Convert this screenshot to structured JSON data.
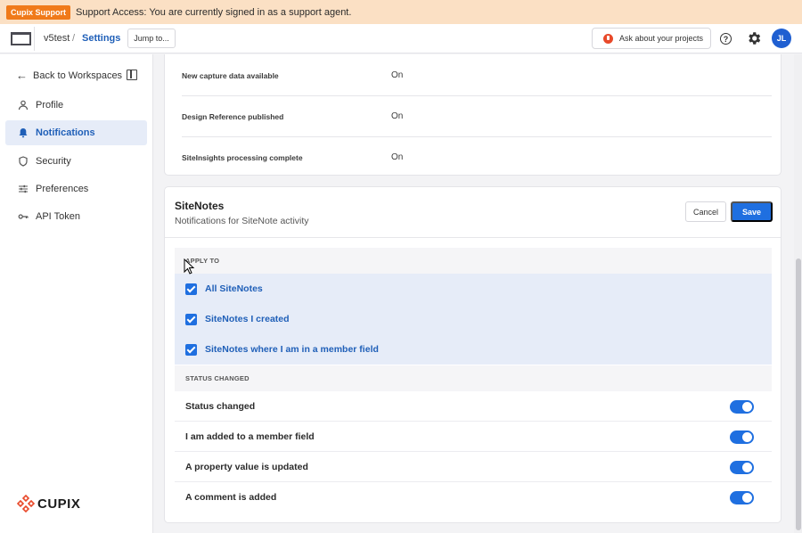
{
  "banner": {
    "badge": "Cupix Support",
    "message": "Support Access: You are currently signed in as a support agent."
  },
  "header": {
    "workspace": "v5test",
    "separator": "/",
    "current": "Settings",
    "jump_label": "Jump to...",
    "ask_label": "Ask about your projects",
    "help_glyph": "?",
    "avatar_initials": "JL"
  },
  "sidebar": {
    "back_label": "Back to Workspaces",
    "items": [
      {
        "label": "Profile",
        "icon": "person-icon"
      },
      {
        "label": "Notifications",
        "icon": "bell-icon",
        "active": true
      },
      {
        "label": "Security",
        "icon": "shield-icon"
      },
      {
        "label": "Preferences",
        "icon": "sliders-icon"
      },
      {
        "label": "API Token",
        "icon": "key-icon"
      }
    ],
    "brand": "CUPIX"
  },
  "top_card": {
    "rows": [
      {
        "label": "New capture data available",
        "value": "On"
      },
      {
        "label": "Design Reference published",
        "value": "On"
      },
      {
        "label": "SiteInsights processing complete",
        "value": "On"
      }
    ]
  },
  "sitenotes": {
    "title": "SiteNotes",
    "subtitle": "Notifications for SiteNote activity",
    "cancel_label": "Cancel",
    "save_label": "Save",
    "apply_header": "APPLY TO",
    "apply_items": [
      {
        "label": "All SiteNotes",
        "checked": true
      },
      {
        "label": "SiteNotes I created",
        "checked": true
      },
      {
        "label": "SiteNotes where I am in a member field",
        "checked": true
      }
    ],
    "status_header": "STATUS CHANGED",
    "toggles": [
      {
        "label": "Status changed",
        "on": true
      },
      {
        "label": "I am added to a member field",
        "on": true
      },
      {
        "label": "A property value is updated",
        "on": true
      },
      {
        "label": "A comment is added",
        "on": true
      }
    ]
  },
  "colors": {
    "accent": "#1f6fe0",
    "banner_bg": "#fbe0c4",
    "badge_bg": "#f07a1a",
    "selected_bg": "#e6ecf8"
  }
}
